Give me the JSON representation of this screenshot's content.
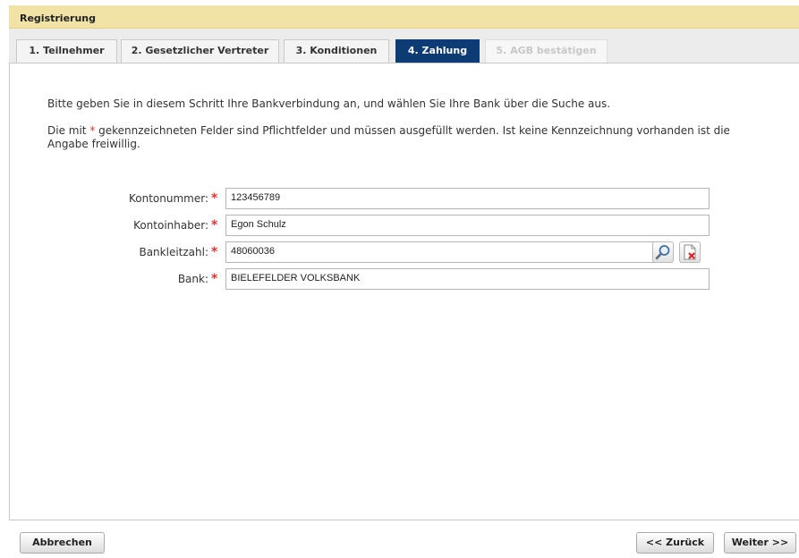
{
  "window": {
    "title": "Registrierung"
  },
  "tabs": [
    {
      "label": "1. Teilnehmer",
      "state": "normal"
    },
    {
      "label": "2. Gesetzlicher Vertreter",
      "state": "normal"
    },
    {
      "label": "3. Konditionen",
      "state": "normal"
    },
    {
      "label": "4. Zahlung",
      "state": "active"
    },
    {
      "label": "5. AGB bestätigen",
      "state": "disabled"
    }
  ],
  "intro": {
    "line1": "Bitte geben Sie in diesem Schritt Ihre Bankverbindung an, und wählen Sie Ihre Bank über die Suche aus.",
    "line2_prefix": "Die mit ",
    "line2_star": "*",
    "line2_suffix": " gekennzeichneten Felder sind Pflichtfelder und müssen ausgefüllt werden. Ist keine Kennzeichnung vorhanden ist die Angabe freiwillig."
  },
  "form": {
    "required_marker": "*",
    "fields": [
      {
        "label": "Kontonummer:",
        "value": "123456789"
      },
      {
        "label": "Kontoinhaber:",
        "value": "Egon Schulz"
      },
      {
        "label": "Bankleitzahl:",
        "value": "48060036"
      },
      {
        "label": "Bank:",
        "value": "BIELEFELDER VOLKSBANK"
      }
    ],
    "icons": {
      "search": "magnifier-icon",
      "clear": "document-delete-icon"
    }
  },
  "footer": {
    "cancel_label": "Abbrechen",
    "back_label": "<< Zurück",
    "next_label": "Weiter >>"
  },
  "colors": {
    "header_bg": "#f1e2a6",
    "active_tab_bg": "#0c3c73",
    "required": "#dd3333"
  }
}
